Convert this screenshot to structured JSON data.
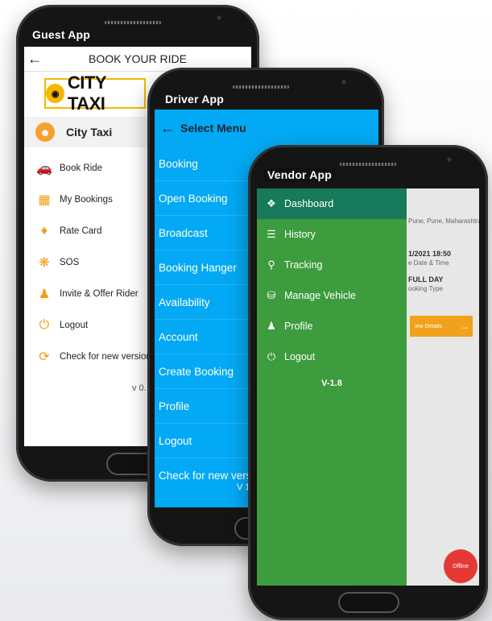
{
  "guest_app": {
    "label": "Guest App",
    "back_symbol": "←",
    "title": "BOOK YOUR RIDE",
    "logo_text": "CITY TAXI",
    "user_name": "City Taxi",
    "menu": [
      {
        "icon": "car-icon",
        "label": "Book Ride"
      },
      {
        "icon": "map-bookings-icon",
        "label": "My Bookings"
      },
      {
        "icon": "tag-icon",
        "label": "Rate Card"
      },
      {
        "icon": "lifebuoy-icon",
        "label": "SOS"
      },
      {
        "icon": "user-icon",
        "label": "Invite & Offer Rider"
      },
      {
        "icon": "power-icon",
        "label": "Logout"
      },
      {
        "icon": "refresh-icon",
        "label": "Check for new version"
      }
    ],
    "version": "v 0."
  },
  "driver_app": {
    "label": "Driver App",
    "back_symbol": "←",
    "title": "Select Menu",
    "menu": [
      "Booking",
      "Open Booking",
      "Broadcast",
      "Booking Hanger",
      "Availability",
      "Account",
      "Create Booking",
      "Profile",
      "Logout",
      "Check for new vers"
    ],
    "version": "V 1"
  },
  "vendor_app": {
    "label": "Vendor App",
    "menu": [
      {
        "icon": "dashboard-icon",
        "label": "Dashboard",
        "active": true
      },
      {
        "icon": "list-icon",
        "label": "History"
      },
      {
        "icon": "location-pin-icon",
        "label": "Tracking"
      },
      {
        "icon": "car-icon",
        "label": "Manage Vehicle"
      },
      {
        "icon": "user-icon",
        "label": "Profile"
      },
      {
        "icon": "power-icon",
        "label": "Logout"
      }
    ],
    "version": "V-1.8",
    "background_card": {
      "address": "Pune, Pune, Maharashtra",
      "datetime": "1/2021 18:50",
      "datetime_label": "e Date & Time",
      "booking_type": "FULL DAY",
      "booking_type_label": "ooking Type",
      "details_button": "iew Details",
      "offline_button": "Offline"
    }
  },
  "colors": {
    "driver_blue": "#03a9f4",
    "vendor_green": "#3d9c3d",
    "vendor_active": "#177a5a",
    "accent_orange": "#f39c12",
    "logo_yellow": "#f5b800"
  }
}
